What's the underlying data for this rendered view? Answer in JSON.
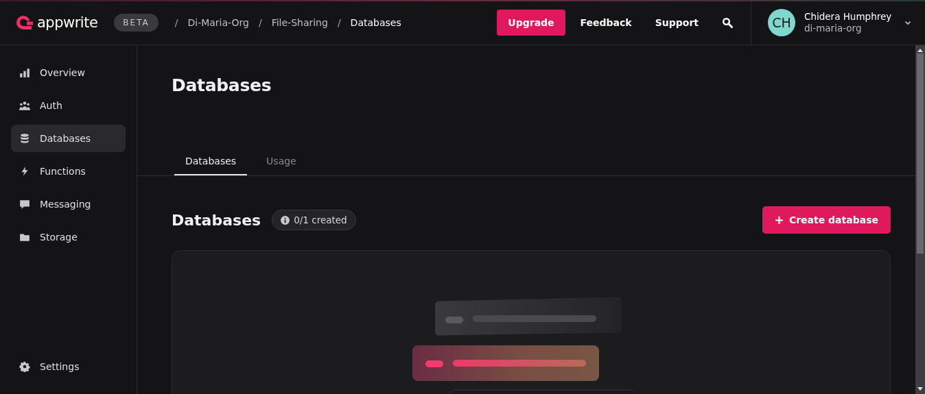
{
  "header": {
    "logo": "appwrite",
    "badge": "BETA",
    "breadcrumbs": [
      {
        "label": "Di-Maria-Org",
        "current": false
      },
      {
        "label": "File-Sharing",
        "current": false
      },
      {
        "label": "Databases",
        "current": true
      }
    ],
    "separator": "/",
    "actions": [
      {
        "label": "Upgrade",
        "kind": "primary"
      },
      {
        "label": "Feedback",
        "kind": "text"
      },
      {
        "label": "Support",
        "kind": "text"
      }
    ],
    "user": {
      "initials": "CH",
      "name": "Chidera Humphrey",
      "org": "di-maria-org"
    }
  },
  "sidebar": {
    "items": [
      {
        "label": "Overview",
        "kind": "chart",
        "selected": false
      },
      {
        "label": "Auth",
        "kind": "users",
        "selected": false
      },
      {
        "label": "Databases",
        "kind": "database",
        "selected": true
      },
      {
        "label": "Functions",
        "kind": "bolt",
        "selected": false
      },
      {
        "label": "Messaging",
        "kind": "message",
        "selected": false
      },
      {
        "label": "Storage",
        "kind": "folder",
        "selected": false
      }
    ],
    "footer": {
      "label": "Settings",
      "kind": "gear",
      "selected": false
    }
  },
  "page": {
    "title": "Databases",
    "tabs": [
      {
        "label": "Databases",
        "selected": true
      },
      {
        "label": "Usage",
        "selected": false
      }
    ],
    "section": {
      "title": "Databases",
      "count": "0/1 created",
      "button": "Create database"
    }
  }
}
